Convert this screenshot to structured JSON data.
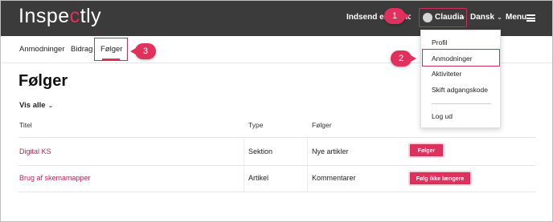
{
  "header": {
    "logo_prefix": "Inspe",
    "logo_accent": "c",
    "logo_suffix": "tly",
    "submit_label": "Indsend en anmodning",
    "user_name": "Claudia",
    "language_label": "Dansk",
    "menu_label": "Menu"
  },
  "tabs": [
    {
      "label": "Anmodninger"
    },
    {
      "label": "Bidrag"
    },
    {
      "label": "Følger"
    }
  ],
  "page_title": "Følger",
  "filter_label": "Vis alle",
  "table": {
    "columns": [
      "Titel",
      "Type",
      "Følger"
    ],
    "rows": [
      {
        "title": "Digital KS",
        "type": "Sektion",
        "follows": "Nye artikler",
        "button": "Følger"
      },
      {
        "title": "Brug af skemamapper",
        "type": "Artikel",
        "follows": "Kommentarer",
        "button": "Følg ikke længere"
      }
    ]
  },
  "dropdown": {
    "items": [
      {
        "label": "Profil"
      },
      {
        "label": "Anmodninger"
      },
      {
        "label": "Aktiviteter"
      },
      {
        "label": "Skift adgangskode"
      },
      {
        "label": "Log ud"
      }
    ]
  },
  "badges": [
    "1",
    "2",
    "3"
  ],
  "colors": {
    "header_bg": "#3b3b3b",
    "accent": "#e0315e",
    "link": "#b3294f"
  },
  "icons": {
    "avatar": "avatar-icon",
    "user_chevron": "chevron-down-icon",
    "language_chevron": "chevron-down-icon",
    "menu": "hamburger-icon",
    "filter_chevron": "chevron-down-icon"
  }
}
